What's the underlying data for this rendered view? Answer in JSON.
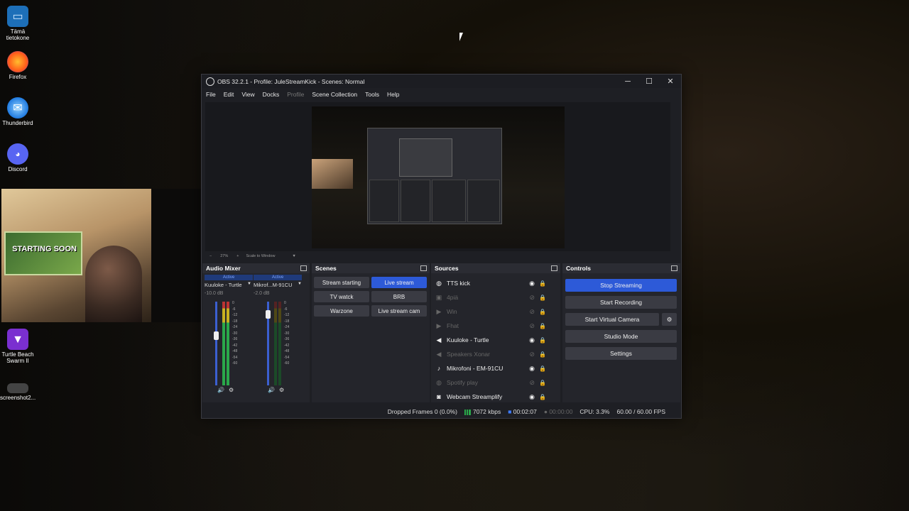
{
  "desktop": {
    "icons": [
      {
        "label": "Tämä tietokone",
        "icon": "monitor-icon",
        "color": "#3aa0e0"
      },
      {
        "label": "Firefox",
        "icon": "firefox-icon",
        "color": "#ff7a1a"
      },
      {
        "label": "Thunderbird",
        "icon": "thunderbird-icon",
        "color": "#1f7ae0"
      },
      {
        "label": "Discord",
        "icon": "discord-icon",
        "color": "#5865f2"
      },
      {
        "label": "Turtle Beach Swarm II",
        "icon": "turtle-beach-icon",
        "color": "#7a2fd0"
      },
      {
        "label": "screenshot2...",
        "icon": "image-file-icon",
        "color": "#777777"
      }
    ],
    "poster_text": "STARTING SOON"
  },
  "obs": {
    "title": "OBS 32.2.1 - Profile: JuleStreamKick - Scenes: Normal",
    "menu": [
      "File",
      "Edit",
      "View",
      "Docks",
      "Profile",
      "Scene Collection",
      "Tools",
      "Help"
    ],
    "preview_bar": {
      "zoom": "27%",
      "scale_mode": "Scale to Window"
    },
    "audio_mixer": {
      "title": "Audio Mixer",
      "channels": [
        {
          "active": "Active",
          "name": "Kuuloke - Turtle",
          "db": "-10.0 dB"
        },
        {
          "active": "Active",
          "name": "Mikrof...M-91CU",
          "db": "-2.0 dB"
        }
      ],
      "ticks": [
        "0",
        "-6",
        "-12",
        "-18",
        "-24",
        "-30",
        "-36",
        "-42",
        "-48",
        "-54",
        "-60"
      ]
    },
    "scenes": {
      "title": "Scenes",
      "items": [
        "Stream starting",
        "Live stream",
        "TV watck",
        "BRB",
        "Warzone",
        "Live stream cam"
      ],
      "selected": "Live stream"
    },
    "sources": {
      "title": "Sources",
      "items": [
        {
          "name": "TTS kick",
          "icon": "browser-icon",
          "visible": true
        },
        {
          "name": "4piä",
          "icon": "image-icon",
          "visible": false
        },
        {
          "name": "Win",
          "icon": "media-icon",
          "visible": false
        },
        {
          "name": "Fhat",
          "icon": "media-icon",
          "visible": false
        },
        {
          "name": "Kuuloke - Turtle",
          "icon": "speaker-icon",
          "visible": true
        },
        {
          "name": "Speakers Xonar",
          "icon": "speaker-icon",
          "visible": false
        },
        {
          "name": "Mikrofoni - EM-91CU",
          "icon": "microphone-icon",
          "visible": true
        },
        {
          "name": "Spotify play",
          "icon": "browser-icon",
          "visible": false
        },
        {
          "name": "Webcam Streamplify",
          "icon": "camera-icon",
          "visible": true
        }
      ]
    },
    "controls": {
      "title": "Controls",
      "stop_streaming": "Stop Streaming",
      "start_recording": "Start Recording",
      "start_virtual_camera": "Start Virtual Camera",
      "studio_mode": "Studio Mode",
      "settings": "Settings"
    },
    "status": {
      "dropped_frames": "Dropped Frames 0 (0.0%)",
      "bitrate": "7072 kbps",
      "stream_time": "00:02:07",
      "record_time": "00:00:00",
      "cpu": "CPU: 3.3%",
      "fps": "60.00 / 60.00 FPS"
    }
  }
}
